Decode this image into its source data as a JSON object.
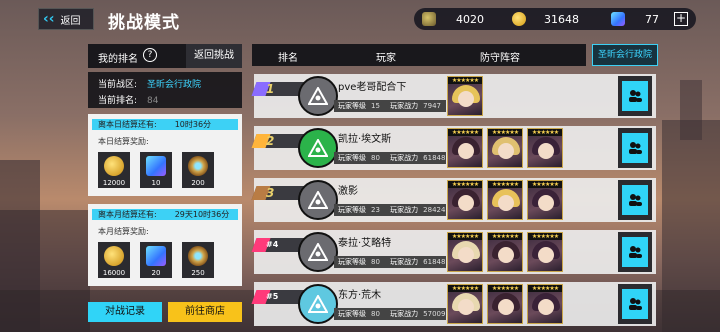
{
  "header": {
    "back_label": "返回",
    "title": "挑战模式"
  },
  "resources": [
    {
      "icon": "token-icon",
      "value": "4020"
    },
    {
      "icon": "gold-coin-icon",
      "value": "31648"
    },
    {
      "icon": "cube-icon",
      "value": "77"
    }
  ],
  "left_panel": {
    "my_rank_label": "我的排名",
    "return_label": "返回挑战",
    "zone_label": "当前战区:",
    "zone_value": "圣昕会行政院",
    "rank_label": "当前排名:",
    "rank_value": "84",
    "daily": {
      "header": "离本日结算还有:",
      "time": "10时36分",
      "reward_label": "本日结算奖励:",
      "items": [
        {
          "icon": "gold-coin-icon",
          "amount": "12000"
        },
        {
          "icon": "cube-icon",
          "amount": "10"
        },
        {
          "icon": "disc-icon",
          "amount": "200"
        }
      ]
    },
    "monthly": {
      "header": "离本月结算还有:",
      "time": "29天10时36分",
      "reward_label": "本月结算奖励:",
      "items": [
        {
          "icon": "gold-coin-icon",
          "amount": "16000"
        },
        {
          "icon": "cube-icon",
          "amount": "20"
        },
        {
          "icon": "disc-icon",
          "amount": "250"
        }
      ]
    },
    "record_label": "对战记录",
    "shop_label": "前往商店"
  },
  "table": {
    "col_rank": "排名",
    "col_player": "玩家",
    "col_lineup": "防守阵容",
    "zone_tag": "圣昕会行政院",
    "level_label": "玩家等级",
    "power_label": "玩家战力",
    "rows": [
      {
        "rank": "1",
        "name": "pve老哥配合下",
        "level": "15",
        "power": "7947",
        "stripe": "#8a6cff",
        "avatar": "#6b6b70",
        "cards": 1
      },
      {
        "rank": "2",
        "name": "凯拉·埃文斯",
        "level": "80",
        "power": "61848",
        "stripe": "#ffb43a",
        "avatar": "#2bb34a",
        "cards": 3
      },
      {
        "rank": "3",
        "name": "激影",
        "level": "23",
        "power": "28424",
        "stripe": "#b97c44",
        "avatar": "#6b6b70",
        "cards": 3
      },
      {
        "rank": "#4",
        "name": "泰拉·艾略特",
        "level": "80",
        "power": "61848",
        "stripe": "#ff3a7a",
        "avatar": "#6b6b70",
        "cards": 3
      },
      {
        "rank": "#5",
        "name": "东方·荒木",
        "level": "80",
        "power": "57009",
        "stripe": "#ff3a7a",
        "avatar": "#5fc8e0",
        "cards": 3
      }
    ]
  }
}
